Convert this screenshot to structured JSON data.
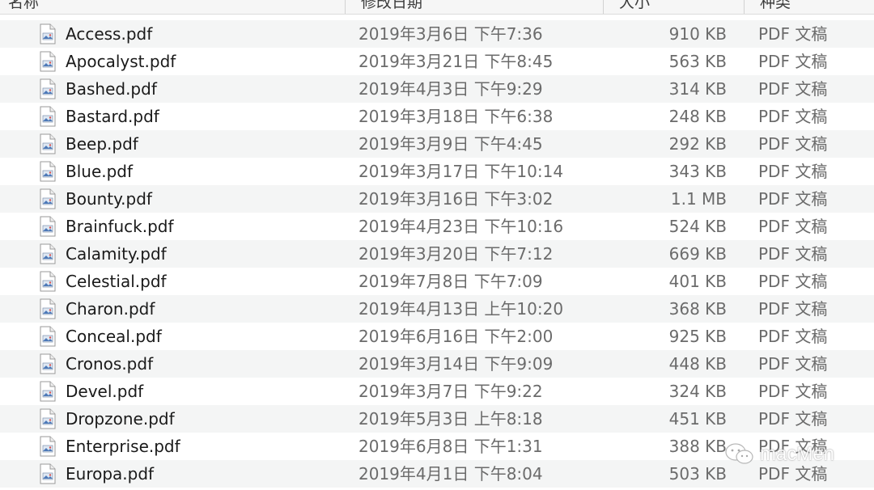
{
  "columns": {
    "name": "名称",
    "date": "修改日期",
    "size": "大小",
    "kind": "种类"
  },
  "icon": "pdf-document-icon",
  "files": [
    {
      "name": "Access.pdf",
      "date": "2019年3月6日 下午7:36",
      "size": "910 KB",
      "kind": "PDF 文稿"
    },
    {
      "name": "Apocalyst.pdf",
      "date": "2019年3月21日 下午8:45",
      "size": "563 KB",
      "kind": "PDF 文稿"
    },
    {
      "name": "Bashed.pdf",
      "date": "2019年4月3日 下午9:29",
      "size": "314 KB",
      "kind": "PDF 文稿"
    },
    {
      "name": "Bastard.pdf",
      "date": "2019年3月18日 下午6:38",
      "size": "248 KB",
      "kind": "PDF 文稿"
    },
    {
      "name": "Beep.pdf",
      "date": "2019年3月9日 下午4:45",
      "size": "292 KB",
      "kind": "PDF 文稿"
    },
    {
      "name": "Blue.pdf",
      "date": "2019年3月17日 下午10:14",
      "size": "343 KB",
      "kind": "PDF 文稿"
    },
    {
      "name": "Bounty.pdf",
      "date": "2019年3月16日 下午3:02",
      "size": "1.1 MB",
      "kind": "PDF 文稿"
    },
    {
      "name": "Brainfuck.pdf",
      "date": "2019年4月23日 下午10:16",
      "size": "524 KB",
      "kind": "PDF 文稿"
    },
    {
      "name": "Calamity.pdf",
      "date": "2019年3月20日 下午7:12",
      "size": "669 KB",
      "kind": "PDF 文稿"
    },
    {
      "name": "Celestial.pdf",
      "date": "2019年7月8日 下午7:09",
      "size": "401 KB",
      "kind": "PDF 文稿"
    },
    {
      "name": "Charon.pdf",
      "date": "2019年4月13日 上午10:20",
      "size": "368 KB",
      "kind": "PDF 文稿"
    },
    {
      "name": "Conceal.pdf",
      "date": "2019年6月16日 下午2:00",
      "size": "925 KB",
      "kind": "PDF 文稿"
    },
    {
      "name": "Cronos.pdf",
      "date": "2019年3月14日 下午9:09",
      "size": "448 KB",
      "kind": "PDF 文稿"
    },
    {
      "name": "Devel.pdf",
      "date": "2019年3月7日 下午9:22",
      "size": "324 KB",
      "kind": "PDF 文稿"
    },
    {
      "name": "Dropzone.pdf",
      "date": "2019年5月3日 上午8:18",
      "size": "451 KB",
      "kind": "PDF 文稿"
    },
    {
      "name": "Enterprise.pdf",
      "date": "2019年6月8日 下午1:31",
      "size": "388 KB",
      "kind": "PDF 文稿"
    },
    {
      "name": "Europa.pdf",
      "date": "2019年4月1日 下午8:04",
      "size": "503 KB",
      "kind": "PDF 文稿"
    }
  ],
  "watermark": {
    "text": "macMen",
    "icon": "wechat-icon"
  }
}
